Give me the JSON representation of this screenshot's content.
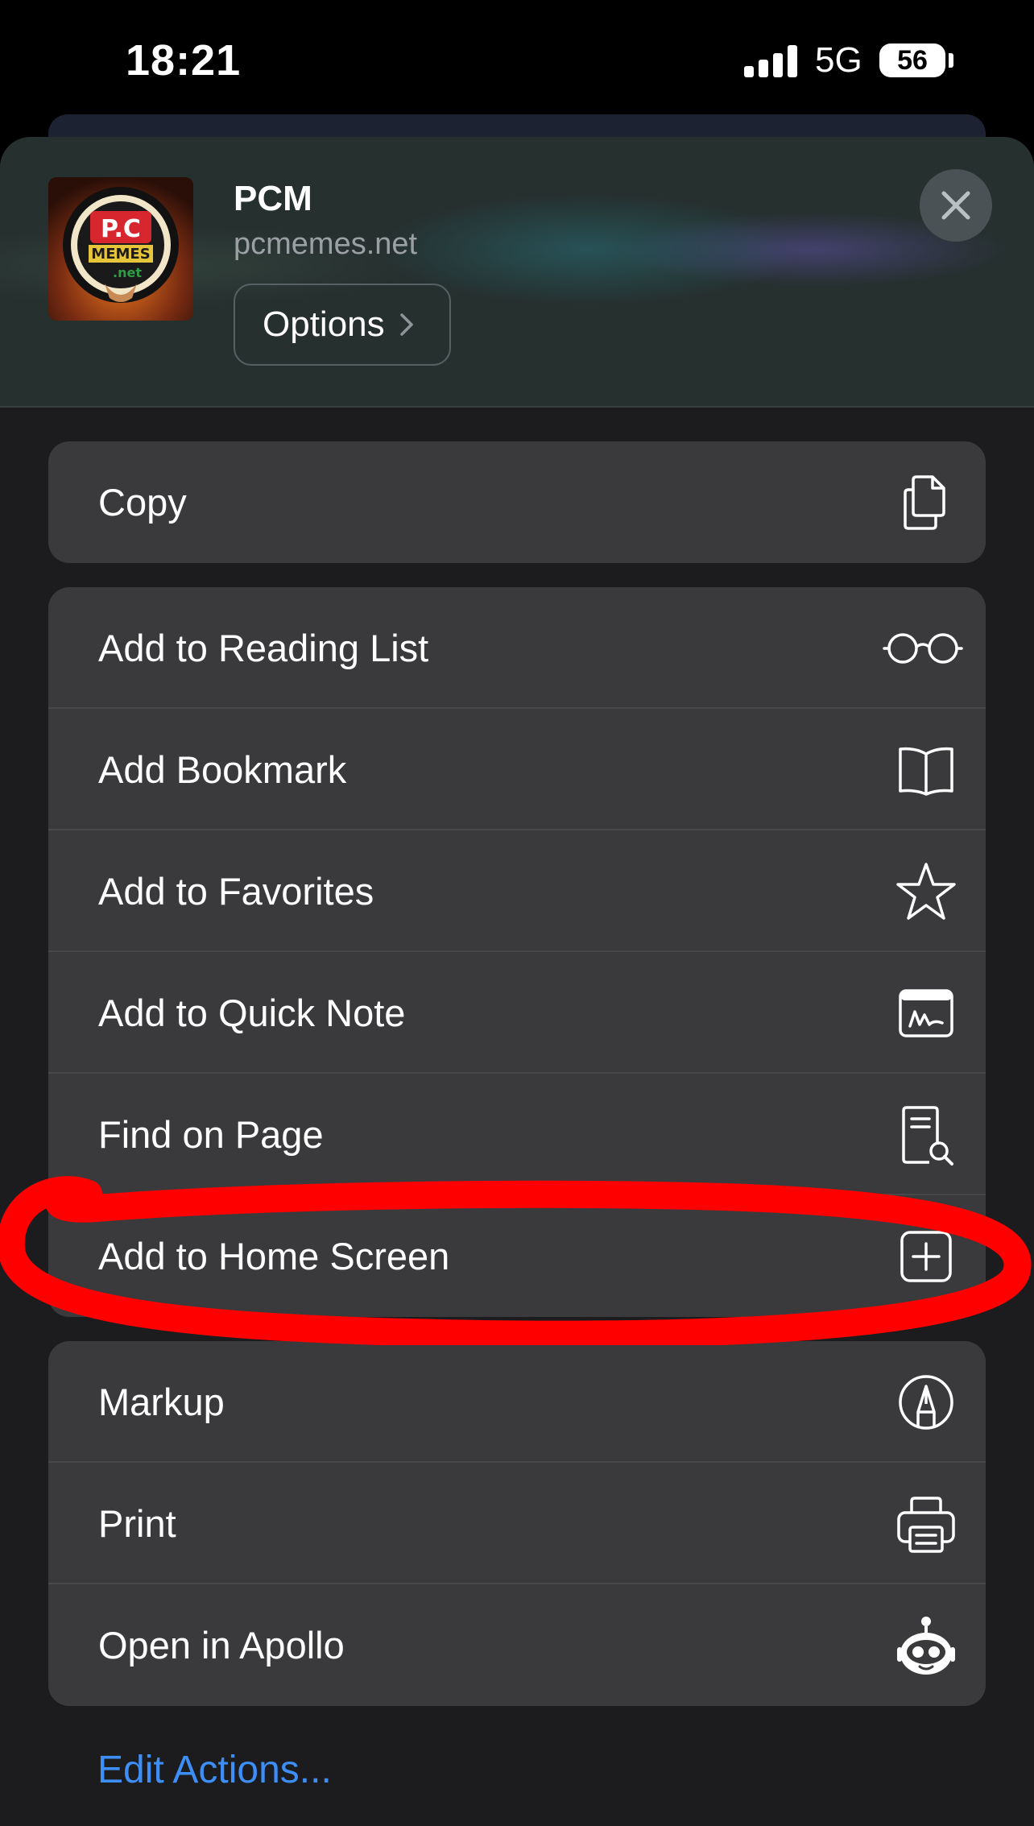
{
  "status_bar": {
    "time": "18:21",
    "network": "5G",
    "battery": "56"
  },
  "header": {
    "title": "PCM",
    "url": "pcmemes.net",
    "options_label": "Options"
  },
  "groups": [
    {
      "items": [
        {
          "label": "Copy",
          "icon": "copy-icon"
        }
      ]
    },
    {
      "items": [
        {
          "label": "Add to Reading List",
          "icon": "glasses-icon"
        },
        {
          "label": "Add Bookmark",
          "icon": "book-icon"
        },
        {
          "label": "Add to Favorites",
          "icon": "star-icon"
        },
        {
          "label": "Add to Quick Note",
          "icon": "quick-note-icon"
        },
        {
          "label": "Find on Page",
          "icon": "find-document-icon"
        },
        {
          "label": "Add to Home Screen",
          "icon": "plus-square-icon"
        }
      ]
    },
    {
      "items": [
        {
          "label": "Markup",
          "icon": "markup-pen-icon"
        },
        {
          "label": "Print",
          "icon": "printer-icon"
        },
        {
          "label": "Open in Apollo",
          "icon": "apollo-robot-icon"
        }
      ]
    }
  ],
  "edit_actions_label": "Edit Actions...",
  "colors": {
    "sheet": "#1c1c1e",
    "row": "#3a3a3c",
    "link": "#3d8ef6",
    "highlight": "#ff0000"
  }
}
